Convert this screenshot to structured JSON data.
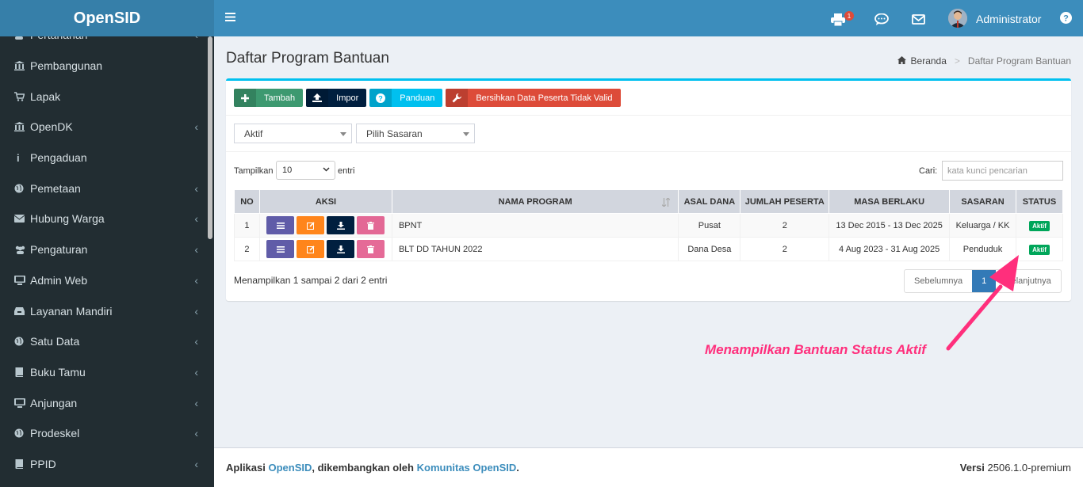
{
  "brand": "OpenSID",
  "sidebar": {
    "items": [
      {
        "label": "Pertanahan",
        "icon": "user-icon",
        "caret": "‹"
      },
      {
        "label": "Pembangunan",
        "icon": "bank-icon",
        "caret": ""
      },
      {
        "label": "Lapak",
        "icon": "cart-icon",
        "caret": ""
      },
      {
        "label": "OpenDK",
        "icon": "bank-icon",
        "caret": "‹"
      },
      {
        "label": "Pengaduan",
        "icon": "info-icon",
        "caret": ""
      },
      {
        "label": "Pemetaan",
        "icon": "globe-icon",
        "caret": "‹"
      },
      {
        "label": "Hubung Warga",
        "icon": "envelope-icon",
        "caret": "‹"
      },
      {
        "label": "Pengaturan",
        "icon": "users-icon",
        "caret": "‹"
      },
      {
        "label": "Admin Web",
        "icon": "desktop-icon",
        "caret": "‹"
      },
      {
        "label": "Layanan Mandiri",
        "icon": "inbox-icon",
        "caret": "‹"
      },
      {
        "label": "Satu Data",
        "icon": "globe-icon",
        "caret": "‹"
      },
      {
        "label": "Buku Tamu",
        "icon": "book-icon",
        "caret": "‹"
      },
      {
        "label": "Anjungan",
        "icon": "desktop-icon",
        "caret": "‹"
      },
      {
        "label": "Prodeskel",
        "icon": "globe-icon",
        "caret": "‹"
      },
      {
        "label": "PPID",
        "icon": "book-icon",
        "caret": "‹"
      }
    ]
  },
  "header": {
    "notification_count": "1",
    "user_name": "Administrator"
  },
  "page": {
    "title": "Daftar Program Bantuan",
    "breadcrumb_home": "Beranda",
    "breadcrumb_sep": ">",
    "breadcrumb_current": "Daftar Program Bantuan"
  },
  "toolbar": {
    "add_label": "Tambah",
    "import_label": "Impor",
    "guide_label": "Panduan",
    "clean_label": "Bersihkan Data Peserta Tidak Valid"
  },
  "filters": {
    "status_value": "Aktif",
    "target_value": "Pilih Sasaran"
  },
  "table_controls": {
    "show_label": "Tampilkan",
    "show_value": "10",
    "entries_label": "entri",
    "search_label": "Cari:",
    "search_placeholder": "kata kunci pencarian"
  },
  "table": {
    "headers": [
      "NO",
      "AKSI",
      "NAMA PROGRAM",
      "ASAL DANA",
      "JUMLAH PESERTA",
      "MASA BERLAKU",
      "SASARAN",
      "STATUS"
    ],
    "rows": [
      {
        "no": "1",
        "name": "BPNT",
        "fund": "Pusat",
        "count": "2",
        "period": "13 Dec 2015 - 13 Dec 2025",
        "target": "Keluarga / KK",
        "status": "Aktif"
      },
      {
        "no": "2",
        "name": "BLT DD TAHUN 2022",
        "fund": "Dana Desa",
        "count": "2",
        "period": "4 Aug 2023 - 31 Aug 2025",
        "target": "Penduduk",
        "status": "Aktif"
      }
    ]
  },
  "pagination": {
    "info": "Menampilkan 1 sampai 2 dari 2 entri",
    "prev_label": "Sebelumnya",
    "current_page": "1",
    "next_label": "Selanjutnya"
  },
  "annotation": {
    "text": "Menampilkan Bantuan Status Aktif",
    "color": "#ff2f7c"
  },
  "footer": {
    "prefix": "Aplikasi",
    "app_link": "OpenSID",
    "middle": ", dikembangkan oleh",
    "community_link": "Komunitas OpenSID",
    "suffix": ".",
    "version_label": "Versi",
    "version_value": "2506.1.0-premium"
  }
}
